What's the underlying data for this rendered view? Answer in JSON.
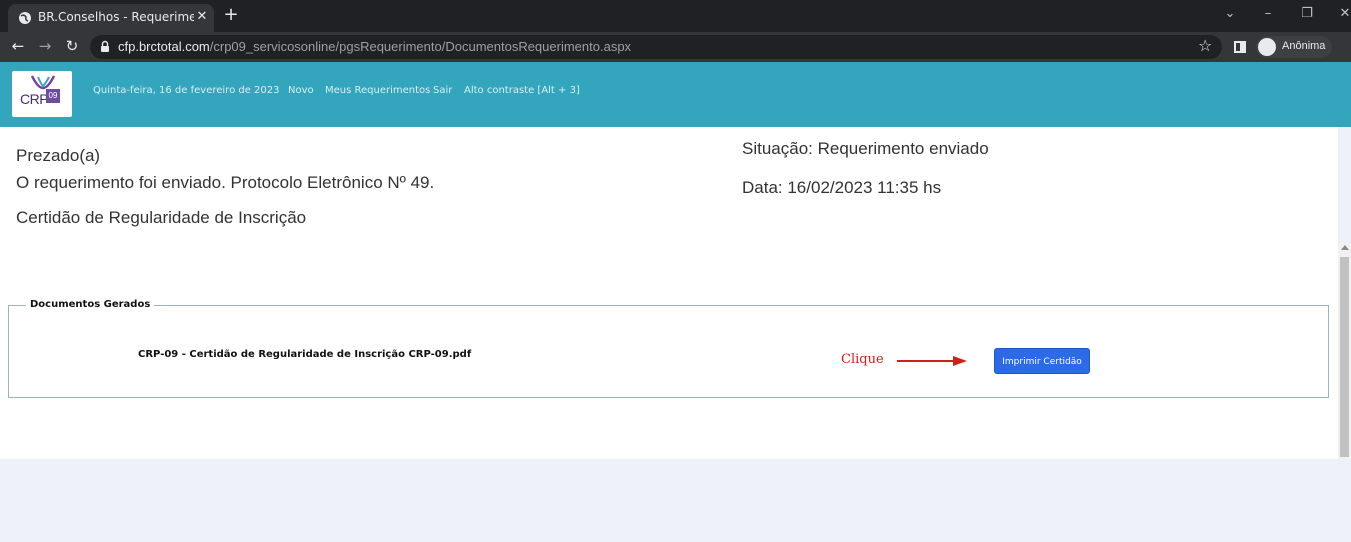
{
  "browser": {
    "tab_title": "BR.Conselhos - Requerimentos O",
    "tab_close": "✕",
    "new_tab": "+",
    "url_domain": "cfp.brctotal.com",
    "url_path": "/crp09_servicosonline/pgsRequerimento/DocumentosRequerimento.aspx",
    "profile_label": "Anônima",
    "minimize": "–",
    "restore": "❐",
    "close": "✕",
    "collapse": "⌄"
  },
  "header": {
    "logo_text": "CRP",
    "logo_badge": "09",
    "date": "Quinta-feira, 16 de fevereiro de 2023",
    "links": [
      "Novo",
      "Meus Requerimentos",
      "Sair",
      "Alto contraste [Alt + 3]"
    ]
  },
  "main": {
    "greeting": "Prezado(a)",
    "message": "O requerimento foi enviado. Protocolo Eletrônico Nº 49.",
    "document_type": "Certidão de Regularidade de Inscrição",
    "status": "Situação: Requerimento enviado",
    "date": "Data: 16/02/2023 11:35 hs"
  },
  "documents": {
    "legend": "Documentos Gerados",
    "file_name": "CRP-09 - Certidão de Regularidade de Inscrição CRP-09.pdf",
    "annotation": "Clique",
    "print_button": "Imprimir Certidão"
  }
}
